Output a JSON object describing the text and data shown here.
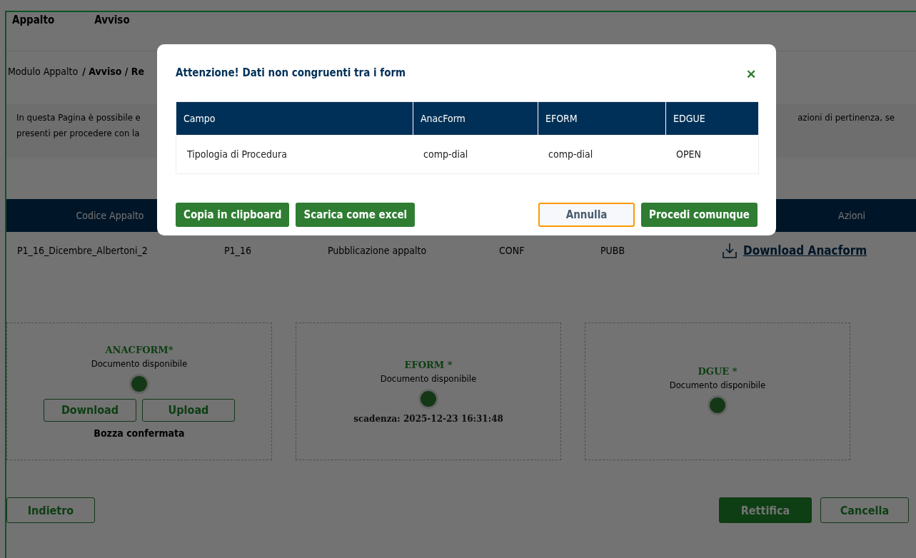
{
  "nav": [
    "Appalto",
    "Avviso"
  ],
  "breadcrumb": {
    "first": "Modulo Appalto",
    "rest": "/ Avviso / Re"
  },
  "info": {
    "left_lines": [
      "In questa Pagina è possibile e",
      "presenti per procedere con la"
    ],
    "right_lines": [
      "azioni di pertinenza, se"
    ]
  },
  "table": {
    "header_first": "Codice Appalto",
    "header_last": "Azioni",
    "row": [
      "P1_16_Dicembre_Albertoni_2",
      "P1_16",
      "Pubblicazione appalto",
      "CONF",
      "PUBB"
    ],
    "action": "Download Anacform"
  },
  "cards": [
    {
      "title": "ANACFORM*",
      "status": "Documento disponibile",
      "buttons": [
        "Download",
        "Upload"
      ],
      "note": "Bozza confermata"
    },
    {
      "title": "EFORM *",
      "status": "Documento disponibile",
      "deadline": "scadenza: 2025-12-23 16:31:48"
    },
    {
      "title": "DGUE *",
      "status": "Documento disponibile"
    }
  ],
  "footer": {
    "left": [
      {
        "label": "Indietro",
        "kind": "outline"
      }
    ],
    "right": [
      {
        "label": "Rettifica",
        "kind": "filled"
      },
      {
        "label": "Cancella",
        "kind": "outline"
      }
    ]
  },
  "modal": {
    "title": "Attenzione! Dati non congruenti tra i form",
    "close": "✕",
    "columns": [
      "Campo",
      "AnacForm",
      "EFORM",
      "EDGUE"
    ],
    "rows": [
      [
        "Tipologia di Procedura",
        "comp-dial",
        "comp-dial",
        "OPEN"
      ]
    ],
    "left_buttons": [
      {
        "label": "Copia in clipboard",
        "kind": "primary",
        "focused": false
      },
      {
        "label": "Scarica come excel",
        "kind": "primary",
        "focused": false
      }
    ],
    "right_buttons": [
      {
        "label": "Annulla",
        "kind": "secondary",
        "focused": true
      },
      {
        "label": "Procedi comunque",
        "kind": "primary",
        "focused": false
      }
    ]
  }
}
